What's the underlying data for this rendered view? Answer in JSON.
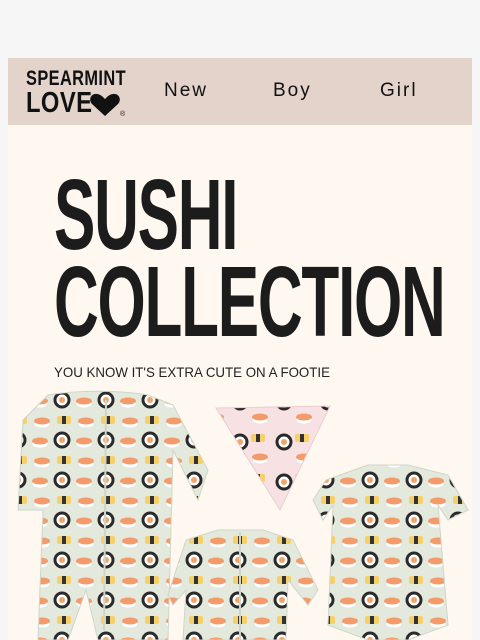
{
  "brand": {
    "line1": "SPEARMINT",
    "line2": "LOVE",
    "mark": "®"
  },
  "nav": {
    "items": [
      {
        "label": "New"
      },
      {
        "label": "Boy"
      },
      {
        "label": "Girl"
      }
    ]
  },
  "hero": {
    "title_line1": "SUSHI",
    "title_line2": "COLLECTION",
    "tagline": "YOU KNOW IT'S EXTRA CUTE ON A FOOTIE"
  },
  "colors": {
    "nav_bg": "#e4d3cb",
    "hero_bg": "#fef8f0",
    "fabric_green": "#e3e8dc",
    "bib_pink": "#f7e1e3"
  },
  "images": {
    "product_photo": "sushi-print-baby-clothing"
  }
}
